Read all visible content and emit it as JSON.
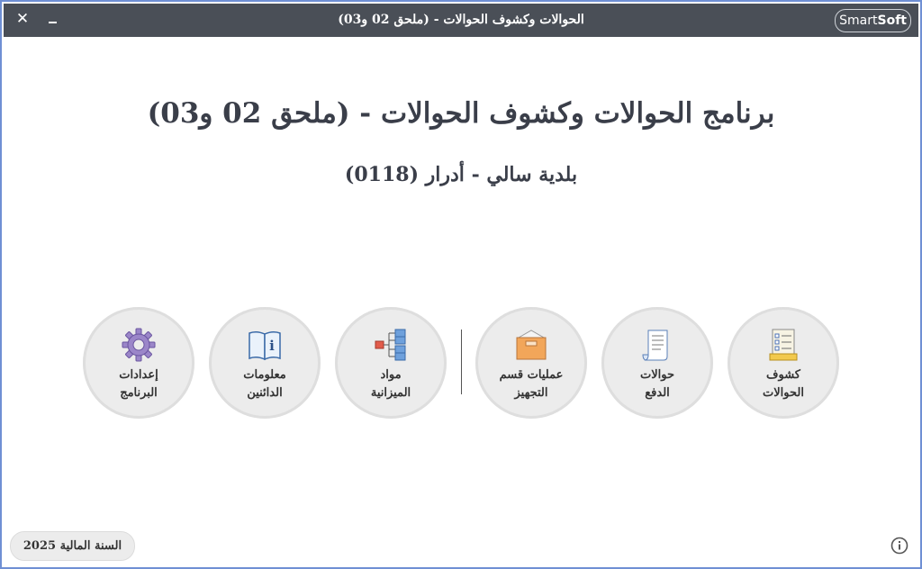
{
  "window": {
    "title": "الحوالات وكشوف الحوالات - (ملحق 02 و03)",
    "logo_part1": "Smart",
    "logo_part2": "Soft",
    "close_glyph": "✕"
  },
  "main": {
    "heading": "برنامج الحوالات وكشوف الحوالات - (ملحق 02 و03)",
    "subheading": "بلدية سالي - أدرار (0118)"
  },
  "tiles": [
    {
      "line1": "كشوف",
      "line2": "الحوالات",
      "icon": "list-form-icon"
    },
    {
      "line1": "حوالات",
      "line2": "الدفع",
      "icon": "document-scroll-icon"
    },
    {
      "line1": "عمليات قسم",
      "line2": "التجهيز",
      "icon": "box-icon"
    },
    {
      "line1": "مواد",
      "line2": "الميزانية",
      "icon": "hierarchy-icon"
    },
    {
      "line1": "معلومات",
      "line2": "الدائنين",
      "icon": "info-book-icon"
    },
    {
      "line1": "إعدادات",
      "line2": "البرنامج",
      "icon": "gear-icon"
    }
  ],
  "footer": {
    "fiscal_year_label": "السنة المالية 2025"
  },
  "colors": {
    "titlebar": "#4a4f57",
    "frame_border": "#6f8fd4",
    "tile_bg": "#ececec",
    "text": "#3a3e49"
  }
}
